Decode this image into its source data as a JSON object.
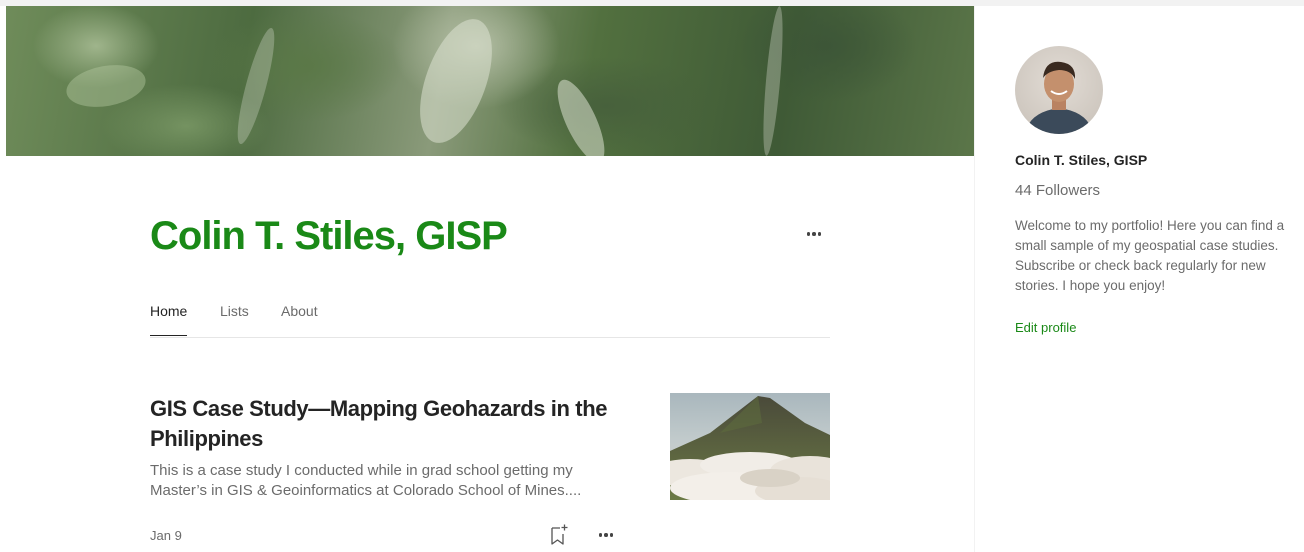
{
  "profile": {
    "name": "Colin T. Stiles, GISP",
    "tabs": [
      {
        "label": "Home",
        "active": true
      },
      {
        "label": "Lists",
        "active": false
      },
      {
        "label": "About",
        "active": false
      }
    ]
  },
  "article": {
    "title": "GIS Case Study—Mapping Geohazards in the Philippines",
    "excerpt_line1": "This is a case study I conducted while in grad school getting my",
    "excerpt_line2": "Master’s in GIS & Geoinformatics at Colorado School of Mines....",
    "date": "Jan 9",
    "thumbnail_icon": "volcano-image"
  },
  "sidebar": {
    "name": "Colin T. Stiles, GISP",
    "followers": "44 Followers",
    "bio": "Welcome to my portfolio! Here you can find a small sample of my geospatial case studies. Subscribe or check back regularly for new stories. I hope you enjoy!",
    "edit_label": "Edit profile"
  },
  "colors": {
    "accent": "#1a8917",
    "text": "#242424",
    "muted": "#6b6b6b",
    "divider": "#e6e6e6"
  },
  "icons": {
    "more": "more-horizontal-icon",
    "bookmark": "bookmark-add-icon"
  }
}
